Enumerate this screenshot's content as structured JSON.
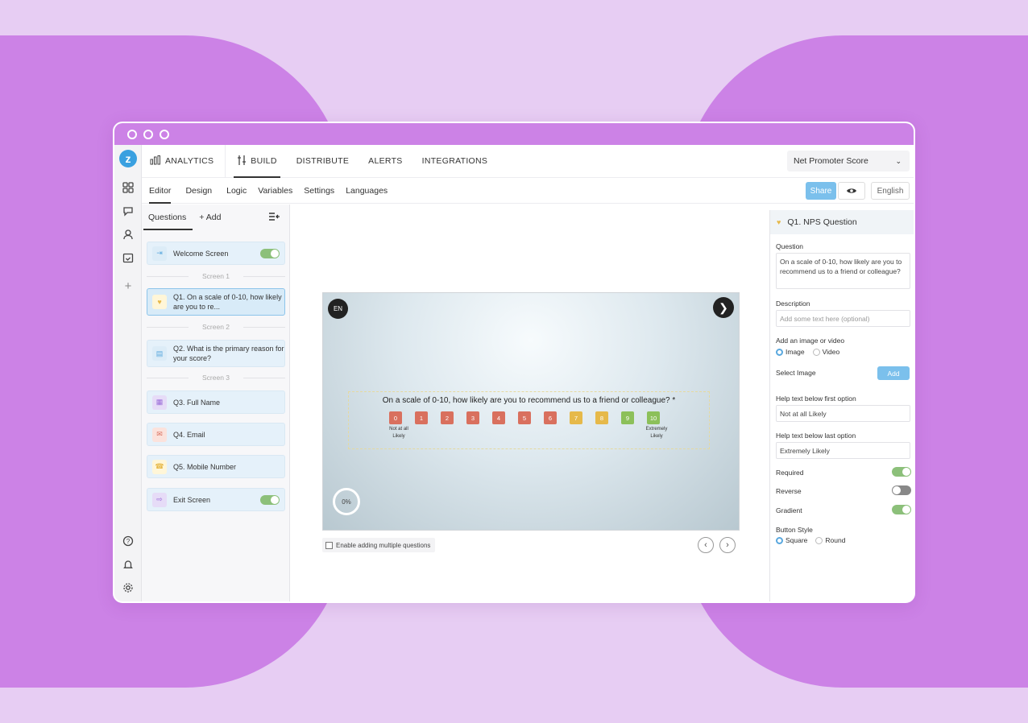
{
  "topnav": {
    "analytics": "ANALYTICS",
    "build": "BUILD",
    "distribute": "DISTRIBUTE",
    "alerts": "ALERTS",
    "integrations": "INTEGRATIONS",
    "survey_select": "Net Promoter Score"
  },
  "subnav": {
    "editor": "Editor",
    "design": "Design",
    "logic": "Logic",
    "variables": "Variables",
    "settings": "Settings",
    "languages": "Languages",
    "share": "Share",
    "language": "English"
  },
  "questions_panel": {
    "tab_questions": "Questions",
    "tab_add": "+ Add",
    "welcome": "Welcome Screen",
    "screen1": "Screen 1",
    "q1": "Q1. On a scale of 0-10, how likely are you to re...",
    "screen2": "Screen 2",
    "q2": "Q2. What is the primary reason for your score?",
    "screen3": "Screen 3",
    "q3": "Q3. Full Name",
    "q4": "Q4. Email",
    "q5": "Q5. Mobile Number",
    "exit": "Exit Screen"
  },
  "preview": {
    "lang_badge": "EN",
    "question": "On a scale of 0-10, how likely are you to recommend us to a friend or colleague? *",
    "scale": [
      {
        "label": "0",
        "color": "#d9705e"
      },
      {
        "label": "1",
        "color": "#d9705e"
      },
      {
        "label": "2",
        "color": "#d9705e"
      },
      {
        "label": "3",
        "color": "#d9705e"
      },
      {
        "label": "4",
        "color": "#d9705e"
      },
      {
        "label": "5",
        "color": "#d9705e"
      },
      {
        "label": "6",
        "color": "#d9705e"
      },
      {
        "label": "7",
        "color": "#e6b94a"
      },
      {
        "label": "8",
        "color": "#e6b94a"
      },
      {
        "label": "9",
        "color": "#8cc05a"
      },
      {
        "label": "10",
        "color": "#8cc05a"
      }
    ],
    "hint_low": "Not at all Likely",
    "hint_high": "Extremely Likely",
    "progress": "0%",
    "multi_label": "Enable adding multiple questions"
  },
  "props": {
    "header": "Q1. NPS Question",
    "question_label": "Question",
    "question_value": "On a scale of 0-10, how likely are you to recommend us to a friend or colleague?",
    "description_label": "Description",
    "description_placeholder": "Add some text here (optional)",
    "media_label": "Add an image or video",
    "media_image": "Image",
    "media_video": "Video",
    "select_image_label": "Select Image",
    "add_button": "Add",
    "help_first_label": "Help text below first option",
    "help_first_value": "Not at all Likely",
    "help_last_label": "Help text below last option",
    "help_last_value": "Extremely Likely",
    "required_label": "Required",
    "reverse_label": "Reverse",
    "gradient_label": "Gradient",
    "button_style_label": "Button Style",
    "style_square": "Square",
    "style_round": "Round"
  }
}
